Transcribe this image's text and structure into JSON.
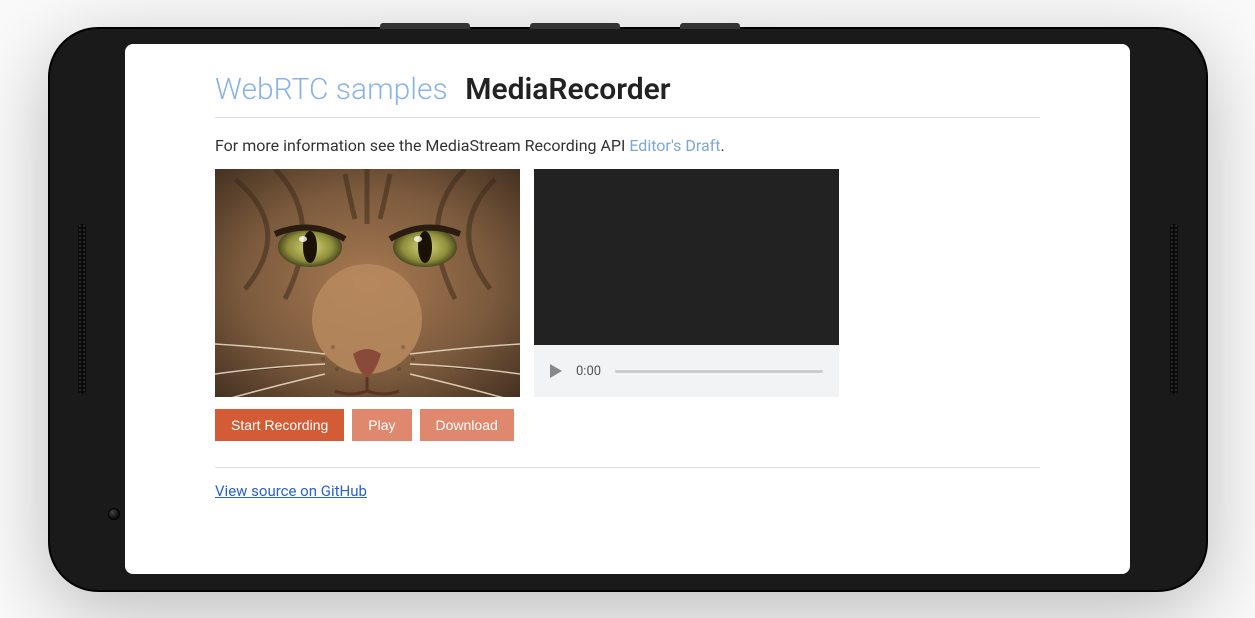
{
  "header": {
    "link_text": "WebRTC samples",
    "title_text": "MediaRecorder"
  },
  "description": {
    "prefix": "For more information see the MediaStream Recording API ",
    "link_text": "Editor's Draft",
    "suffix": "."
  },
  "player": {
    "time_label": "0:00"
  },
  "buttons": {
    "start": "Start Recording",
    "play": "Play",
    "download": "Download"
  },
  "footer": {
    "source_link": "View source on GitHub"
  }
}
